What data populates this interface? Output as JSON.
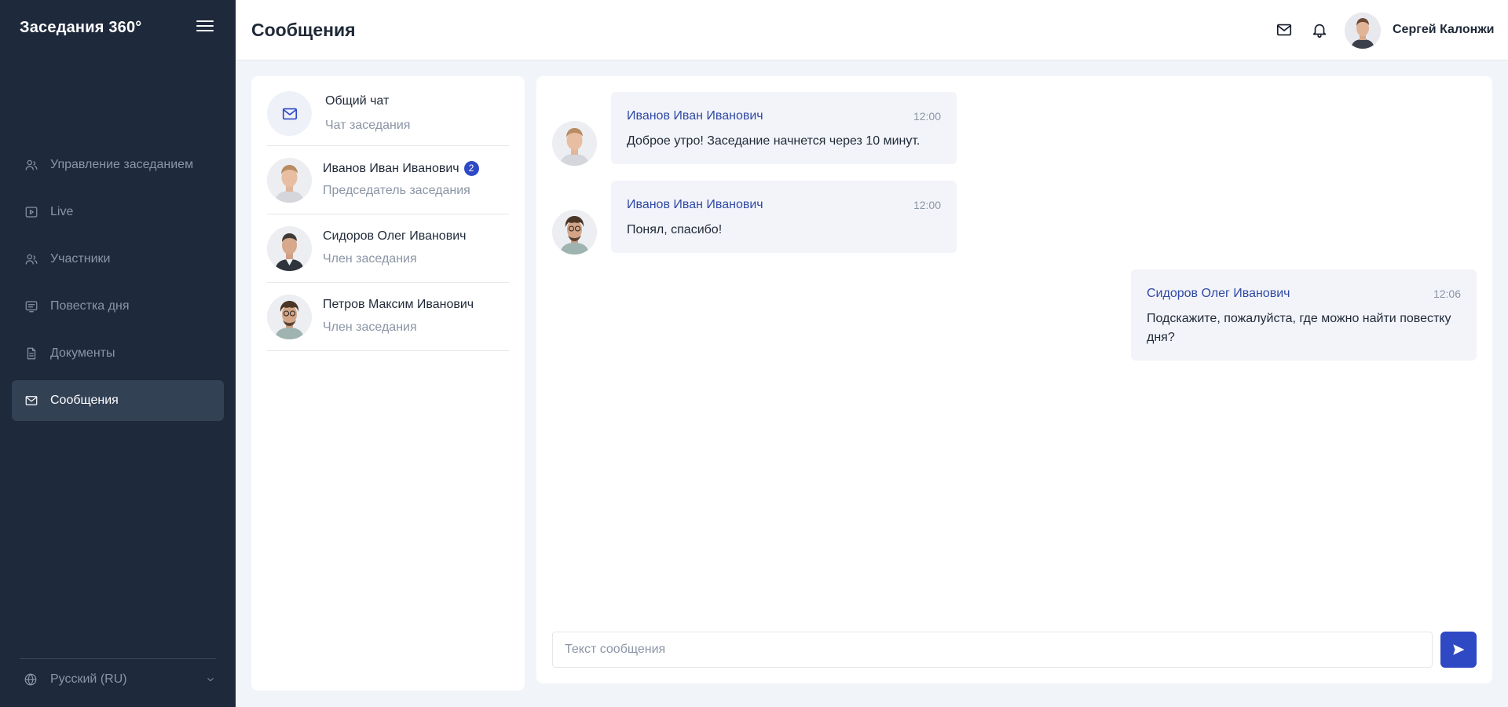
{
  "app": {
    "brand": "Заседания 360°"
  },
  "sidebar": {
    "items": [
      {
        "label": "Управление заседанием",
        "icon": "users-icon"
      },
      {
        "label": "Live",
        "icon": "play-icon"
      },
      {
        "label": "Участники",
        "icon": "users-icon"
      },
      {
        "label": "Повестка дня",
        "icon": "agenda-icon"
      },
      {
        "label": "Документы",
        "icon": "document-icon"
      },
      {
        "label": "Сообщения",
        "icon": "mail-icon",
        "active": true
      }
    ],
    "language": "Русский (RU)"
  },
  "header": {
    "title": "Сообщения",
    "user_name": "Сергей Калонжи"
  },
  "chats": [
    {
      "name": "Общий чат",
      "subtitle": "Чат заседания",
      "type": "general"
    },
    {
      "name": "Иванов Иван Иванович",
      "subtitle": "Председатель заседания",
      "unread": "2"
    },
    {
      "name": "Сидоров Олег Иванович",
      "subtitle": "Член заседания"
    },
    {
      "name": "Петров Максим Иванович",
      "subtitle": "Член заседания"
    }
  ],
  "messages": [
    {
      "sender": "Иванов Иван Иванович",
      "time": "12:00",
      "text": "Доброе утро! Заседание начнется через 10 минут.",
      "side": "left"
    },
    {
      "sender": "Иванов Иван Иванович",
      "time": "12:00",
      "text": "Понял, спасибо!",
      "side": "left"
    },
    {
      "sender": "Сидоров Олег Иванович",
      "time": "12:06",
      "text": "Подскажите, пожалуйста, где можно найти повестку дня?",
      "side": "right"
    }
  ],
  "composer": {
    "placeholder": "Текст сообщения"
  },
  "colors": {
    "sidebar_bg": "#1e293b",
    "accent": "#2f49c4",
    "sender": "#2f49a4",
    "bubble_bg": "#f3f4fa"
  }
}
